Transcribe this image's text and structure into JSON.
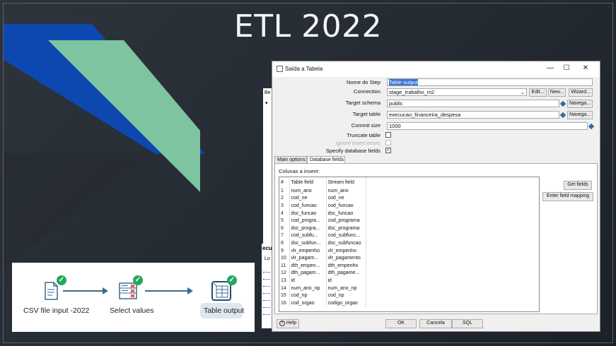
{
  "slide": {
    "title": "ETL 2022",
    "colors": {
      "blue": "#0d47b0",
      "green": "#7ec4a0"
    }
  },
  "flow": {
    "steps": [
      {
        "label": "CSV file input -2022",
        "icon": "csv-file-icon"
      },
      {
        "label": "Select values",
        "icon": "select-values-icon"
      },
      {
        "label": "Table output",
        "icon": "table-output-icon"
      }
    ]
  },
  "dialog": {
    "title": "Saída a Tabela",
    "minimize": "—",
    "maximize": "☐",
    "close": "✕",
    "fields": {
      "step_name_label": "Nome do Step",
      "step_name_value": "Table output",
      "connection_label": "Connection",
      "connection_value": "stage_trabalho_m2",
      "edit_btn": "Edit...",
      "new_btn": "New...",
      "wizard_btn": "Wizard...",
      "schema_label": "Target schema",
      "schema_value": "public",
      "browse_btn": "Navega...",
      "table_label": "Target table",
      "table_value": "execucao_financeira_despesa",
      "browse_btn2": "Navega...",
      "commit_label": "Commit size",
      "commit_value": "1000",
      "truncate_label": "Truncate table",
      "ignore_label": "Ignore insert errors",
      "specify_label": "Specify database fields"
    },
    "tabs": [
      "Main options",
      "Database fields"
    ],
    "active_tab": "Database fields",
    "columns_label": "Colunas a inserir:",
    "grid_headers": [
      "#",
      "Table field",
      "Stream field"
    ],
    "rows": [
      [
        "1",
        "num_ano",
        "num_ano"
      ],
      [
        "2",
        "cod_ne",
        "cod_ne"
      ],
      [
        "3",
        "cod_funcao",
        "cod_funcao"
      ],
      [
        "4",
        "dsc_funcao",
        "dsc_funcao"
      ],
      [
        "5",
        "cod_progra...",
        "cod_programa"
      ],
      [
        "6",
        "dsc_progra...",
        "dsc_programa"
      ],
      [
        "7",
        "cod_subfu...",
        "cod_subfunc..."
      ],
      [
        "8",
        "dsc_subfun...",
        "dsc_subfuncao"
      ],
      [
        "9",
        "vlr_empenho",
        "vlr_empenho"
      ],
      [
        "10",
        "vlr_pagam...",
        "vlr_pagamento"
      ],
      [
        "11",
        "dth_empen...",
        "dth_empenho"
      ],
      [
        "12",
        "dth_pagam...",
        "dth_pagame..."
      ],
      [
        "13",
        "id",
        "id"
      ],
      [
        "14",
        "num_ano_np",
        "num_ano_np"
      ],
      [
        "15",
        "cod_np",
        "cod_np"
      ],
      [
        "16",
        "cod_orgao",
        "codigo_orgao"
      ]
    ],
    "get_fields_btn": "Get fields",
    "mapping_btn": "Enter field mapping",
    "help_btn": "Help",
    "ok_btn": "OK",
    "cancel_btn": "Cancela",
    "sql_btn": "SQL"
  },
  "background_app": {
    "label_be": "Be",
    "label_ecu": "ecu",
    "label_lo": "Lo"
  }
}
